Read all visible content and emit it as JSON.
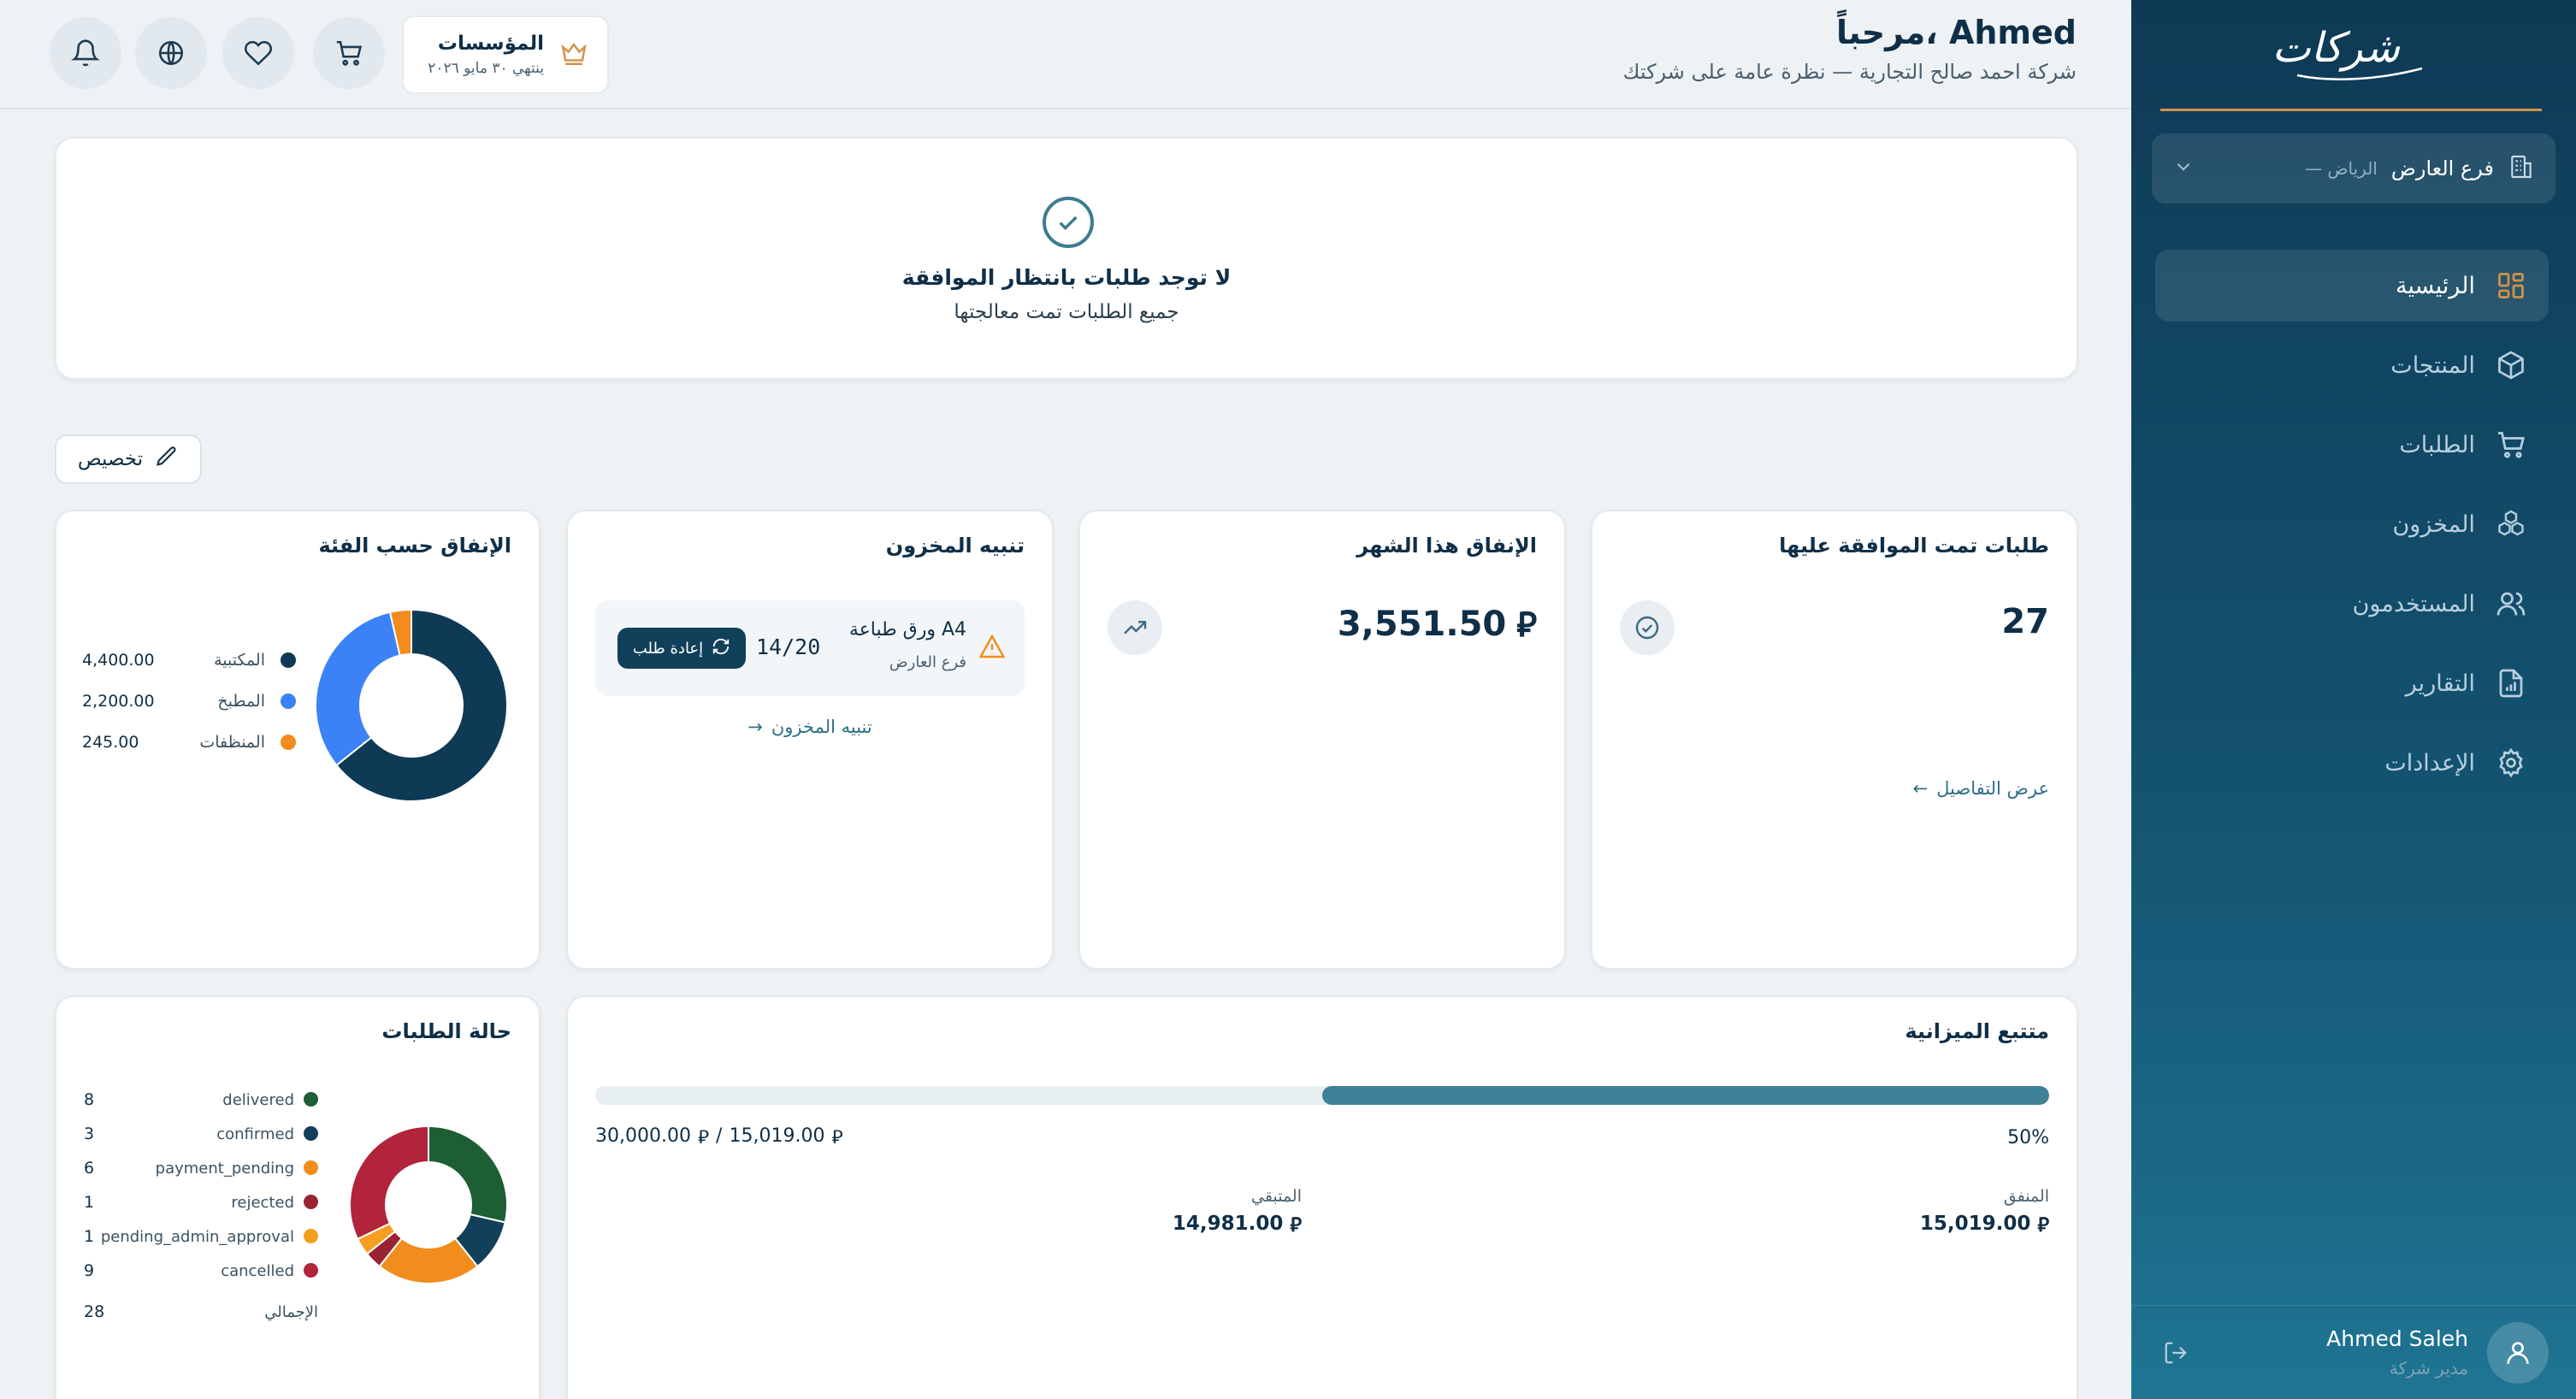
{
  "app": {
    "logo_text": "شركات"
  },
  "sidebar": {
    "branch": {
      "name": "فرع العارض",
      "city": "— الرياض"
    },
    "items": [
      {
        "label": "الرئيسية",
        "icon": "grid-icon",
        "active": true
      },
      {
        "label": "المنتجات",
        "icon": "box-icon",
        "active": false
      },
      {
        "label": "الطلبات",
        "icon": "cart-icon",
        "active": false
      },
      {
        "label": "المخزون",
        "icon": "boxes-icon",
        "active": false
      },
      {
        "label": "المستخدمون",
        "icon": "users-icon",
        "active": false
      },
      {
        "label": "التقارير",
        "icon": "report-icon",
        "active": false
      },
      {
        "label": "الإعدادات",
        "icon": "gear-icon",
        "active": false
      }
    ],
    "user": {
      "name": "Ahmed Saleh",
      "role": "مدير شركة"
    }
  },
  "header": {
    "title": "مرحباً، Ahmed",
    "subtitle": "شركة احمد صالح التجارية — نظرة عامة على شركتك",
    "plan": {
      "name": "المؤسسات",
      "expiry": "ينتهي ٣٠ مايو ٢٠٢٦"
    }
  },
  "pending": {
    "title": "لا توجد طلبات بانتظار الموافقة",
    "subtitle": "جميع الطلبات تمت معالجتها"
  },
  "customize_label": "تخصيص",
  "approved_orders": {
    "title": "طلبات تمت الموافقة عليها",
    "value": "27",
    "link": "عرض التفاصيل"
  },
  "monthly_spend": {
    "title": "الإنفاق هذا الشهر",
    "value": "3,551.50",
    "currency": "⃁"
  },
  "stock_alert": {
    "title": "تنبيه المخزون",
    "item_name": "ورق طباعة A4",
    "item_branch": "فرع العارض",
    "qty": "14/20",
    "reorder_label": "إعادة طلب",
    "link": "تنبيه المخزون"
  },
  "spend_by_category": {
    "title": "الإنفاق حسب الفئة",
    "rows": [
      {
        "label": "المكتبية",
        "value": "4,400.00",
        "color": "#0e3a55"
      },
      {
        "label": "المطبخ",
        "value": "2,200.00",
        "color": "#3b82f6"
      },
      {
        "label": "المنظفات",
        "value": "245.00",
        "color": "#f28c1c"
      }
    ]
  },
  "budget": {
    "title": "متتبع الميزانية",
    "percent_label": "50%",
    "percent": 0.5,
    "total": "30,000.00",
    "spent_total": "15,019.00",
    "spent_label": "المنفق",
    "spent_value": "15,019.00",
    "remaining_label": "المتبقي",
    "remaining_value": "14,981.00"
  },
  "order_status": {
    "title": "حالة الطلبات",
    "rows": [
      {
        "label": "delivered",
        "value": "8",
        "color": "#1e5e35"
      },
      {
        "label": "confirmed",
        "value": "3",
        "color": "#12405b"
      },
      {
        "label": "payment_pending",
        "value": "6",
        "color": "#f28c1c"
      },
      {
        "label": "rejected",
        "value": "1",
        "color": "#9a2233"
      },
      {
        "label": "pending_admin_approval",
        "value": "1",
        "color": "#f59e20"
      },
      {
        "label": "cancelled",
        "value": "9",
        "color": "#b1243b"
      }
    ],
    "total_label": "الإجمالي",
    "total_value": "28"
  },
  "chart_data": [
    {
      "type": "pie",
      "labels": [
        "المكتبية",
        "المطبخ",
        "المنظفات"
      ],
      "values": [
        4400,
        2200,
        245
      ],
      "colors": [
        "#0e3a55",
        "#3b82f6",
        "#f28c1c"
      ]
    },
    {
      "type": "pie",
      "labels": [
        "delivered",
        "confirmed",
        "payment_pending",
        "rejected",
        "pending_admin_approval",
        "cancelled"
      ],
      "values": [
        8,
        3,
        6,
        1,
        1,
        9
      ],
      "colors": [
        "#1e5e35",
        "#12405b",
        "#f28c1c",
        "#9a2233",
        "#f59e20",
        "#b1243b"
      ]
    }
  ]
}
